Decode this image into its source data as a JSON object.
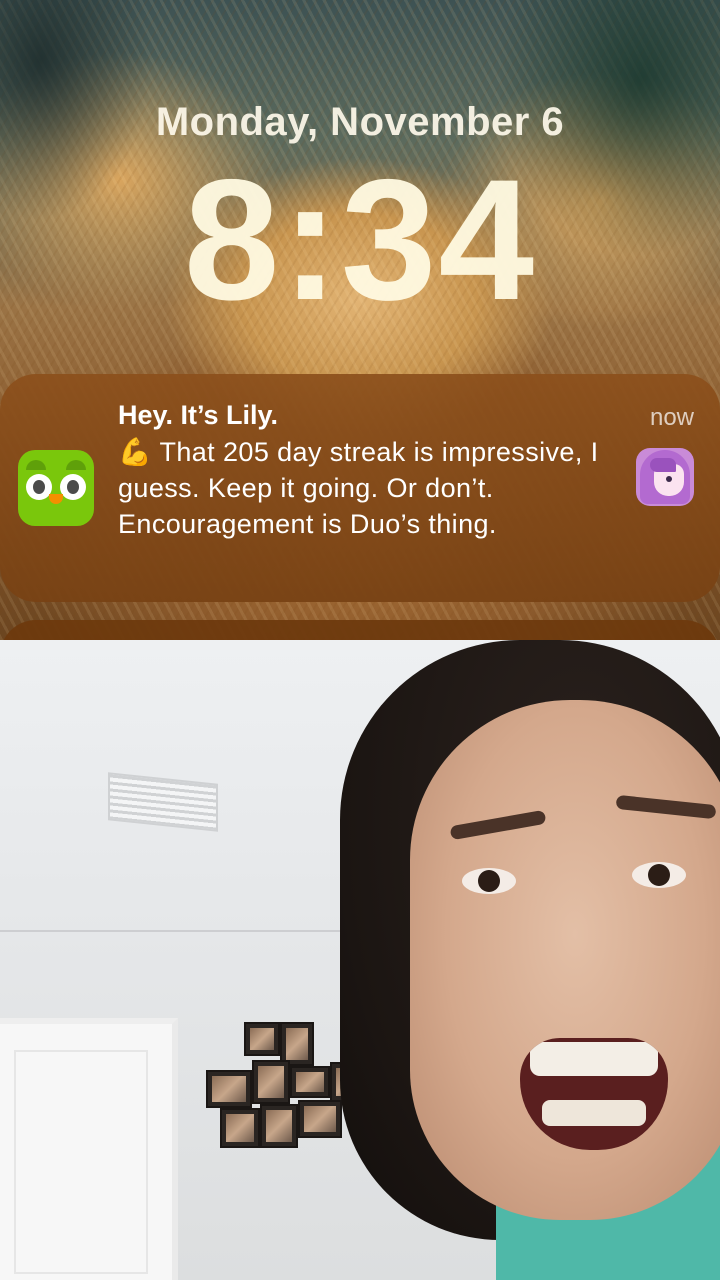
{
  "lock_screen": {
    "date": "Monday, November 6",
    "time": "8:34"
  },
  "notification": {
    "app_icon": "duolingo-owl-icon",
    "title": "Hey. It’s Lily.",
    "timestamp": "now",
    "body_emoji": "💪",
    "body_text": "That 205 day streak is impressive, I guess. Keep it going. Or don’t. Encouragement is Duo’s thing.",
    "avatar": "lily-avatar-icon",
    "colors": {
      "app_icon_bg": "#7ac70c",
      "banner_bg": "#8c501c"
    }
  },
  "video": {
    "description_icons": [
      "ceiling-vent",
      "door",
      "photo-collage",
      "person"
    ]
  }
}
